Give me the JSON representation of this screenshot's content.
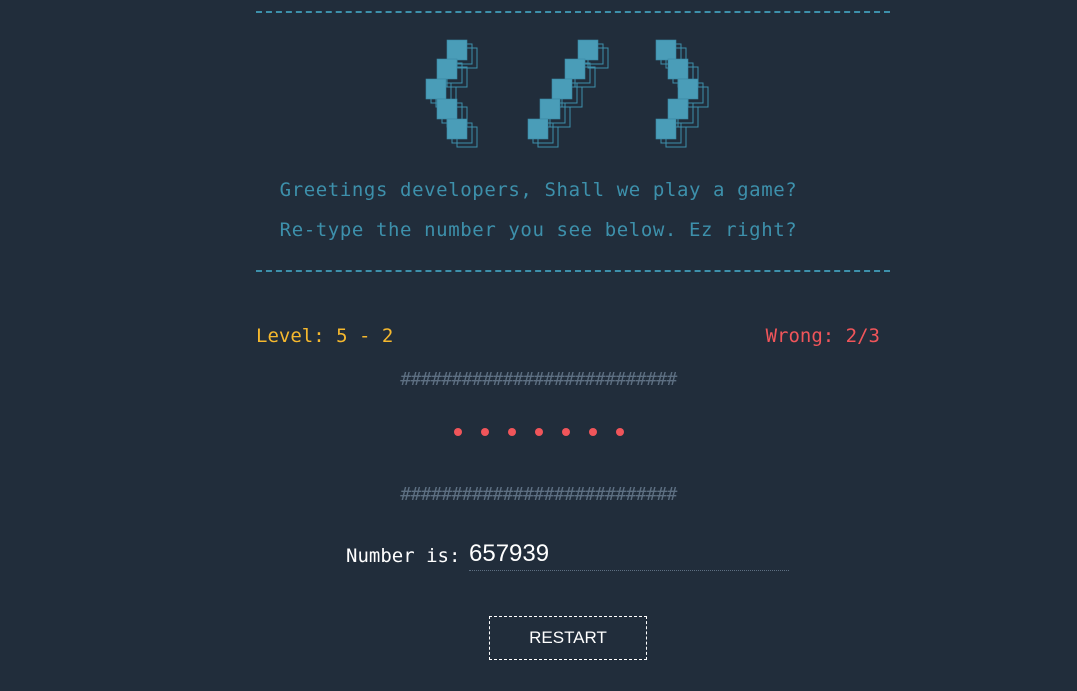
{
  "header": {
    "logo_icon": "code-brackets-pixel-logo",
    "greeting_line_1": "Greetings developers, Shall we play a game?",
    "greeting_line_2": "Re-type the number you see below. Ez right?"
  },
  "status": {
    "level_text": "Level: 5 - 2",
    "wrong_text": "Wrong: 2/3"
  },
  "puzzle": {
    "hash_line": "###########################",
    "hidden_digit_count": 7
  },
  "answer": {
    "label": "Number is:",
    "value": "657939"
  },
  "controls": {
    "restart_label": "RESTART"
  },
  "colors": {
    "background": "#212d3b",
    "accent": "#3d90ab",
    "level": "#f5b82e",
    "wrong": "#f0555a"
  }
}
